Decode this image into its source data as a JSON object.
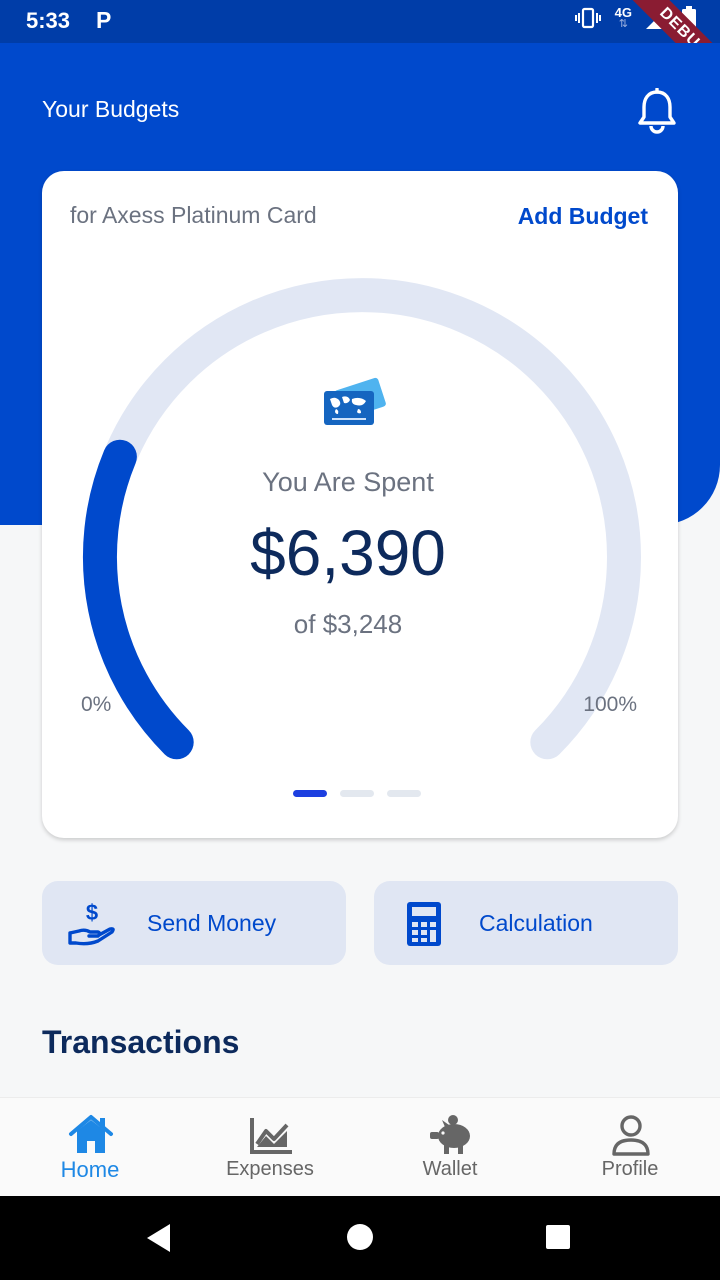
{
  "status_bar": {
    "time": "5:33",
    "app_badge": "P",
    "network": "4G",
    "debug_label": "DEBUG"
  },
  "header": {
    "title": "Your Budgets"
  },
  "budget_card": {
    "card_name": "for Axess Platinum Card",
    "add_label": "Add Budget",
    "spent_label": "You Are Spent",
    "spent_amount": "$6,390",
    "budget_total": "of $3,248",
    "min_label": "0%",
    "max_label": "100%",
    "progress_fraction": 0.25,
    "page_count": 3,
    "active_page": 0
  },
  "actions": [
    {
      "label": "Send Money",
      "icon": "hand-dollar-icon"
    },
    {
      "label": "Calculation",
      "icon": "calculator-icon"
    }
  ],
  "transactions": {
    "title": "Transactions"
  },
  "bottom_nav": [
    {
      "label": "Home",
      "icon": "home-icon",
      "active": true
    },
    {
      "label": "Expenses",
      "icon": "chart-icon",
      "active": false
    },
    {
      "label": "Wallet",
      "icon": "piggy-bank-icon",
      "active": false
    },
    {
      "label": "Profile",
      "icon": "person-icon",
      "active": false
    }
  ],
  "colors": {
    "primary": "#0049cc",
    "accent_nav": "#1e88e5",
    "track": "#e1e7f4",
    "dark_text": "#0d2a5c"
  }
}
